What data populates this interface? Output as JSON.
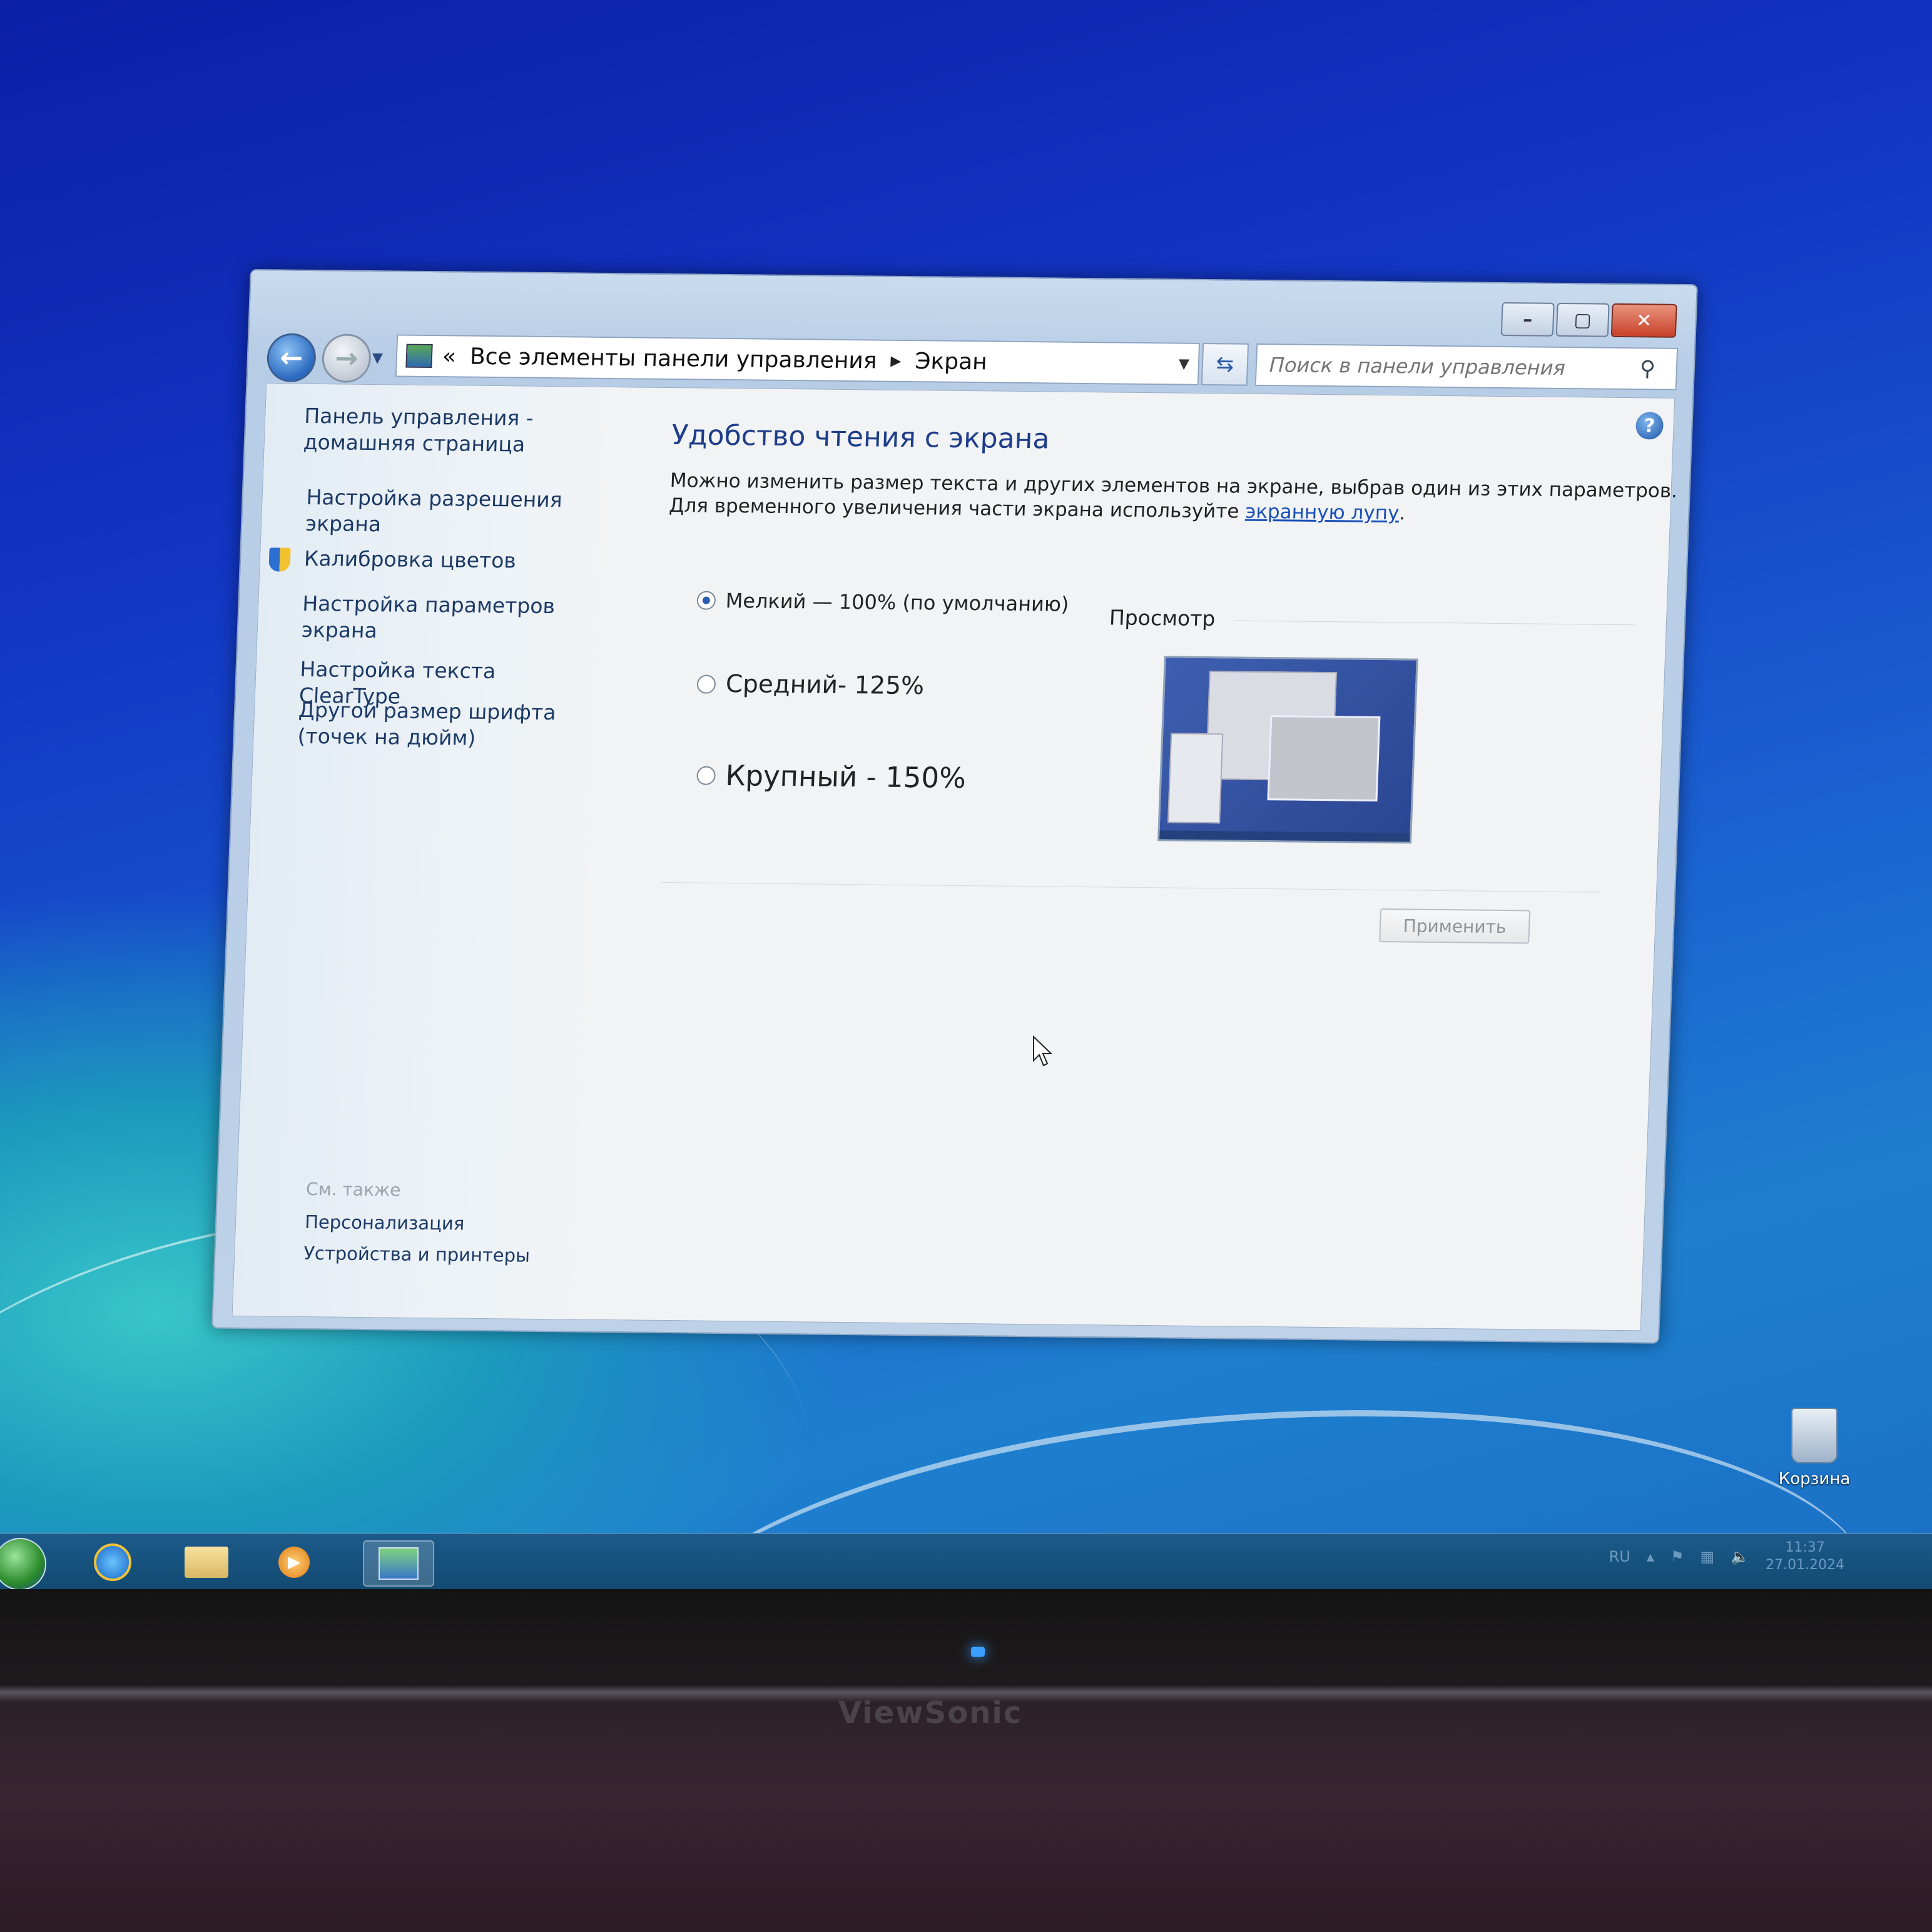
{
  "window": {
    "breadcrumb": {
      "overflow": "«",
      "parent": "Все элементы панели управления",
      "current": "Экран"
    },
    "search_placeholder": "Поиск в панели управления"
  },
  "sidebar": {
    "items": [
      {
        "label": "Панель управления - домашняя страница"
      },
      {
        "label": "Настройка разрешения экрана"
      },
      {
        "label": "Калибровка цветов"
      },
      {
        "label": "Настройка параметров экрана"
      },
      {
        "label": "Настройка текста ClearType"
      },
      {
        "label": "Другой размер шрифта (точек на дюйм)"
      }
    ],
    "see_also": {
      "heading": "См. также",
      "items": [
        {
          "label": "Персонализация"
        },
        {
          "label": "Устройства и принтеры"
        }
      ]
    }
  },
  "main": {
    "title": "Удобство чтения с экрана",
    "desc_line1": "Можно изменить размер текста и других элементов на экране, выбрав один из этих параметров.",
    "desc_line2_prefix": "Для временного увеличения части экрана используйте ",
    "desc_link": "экранную лупу",
    "desc_line2_suffix": ".",
    "options": [
      {
        "label": "Мелкий — 100% (по умолчанию)",
        "selected": true
      },
      {
        "label": "Средний- 125%",
        "selected": false
      },
      {
        "label": "Крупный - 150%",
        "selected": false
      }
    ],
    "preview_label": "Просмотр",
    "apply_label": "Применить"
  },
  "desktop": {
    "recycle_bin_label": "Корзина"
  },
  "taskbar": {
    "language": "RU",
    "time": "11:37",
    "date": "27.01.2024"
  },
  "monitor": {
    "brand": "ViewSonic"
  },
  "colors": {
    "accent_title": "#1e3d8a",
    "link": "#1a50b8",
    "close_button": "#c8412a"
  }
}
